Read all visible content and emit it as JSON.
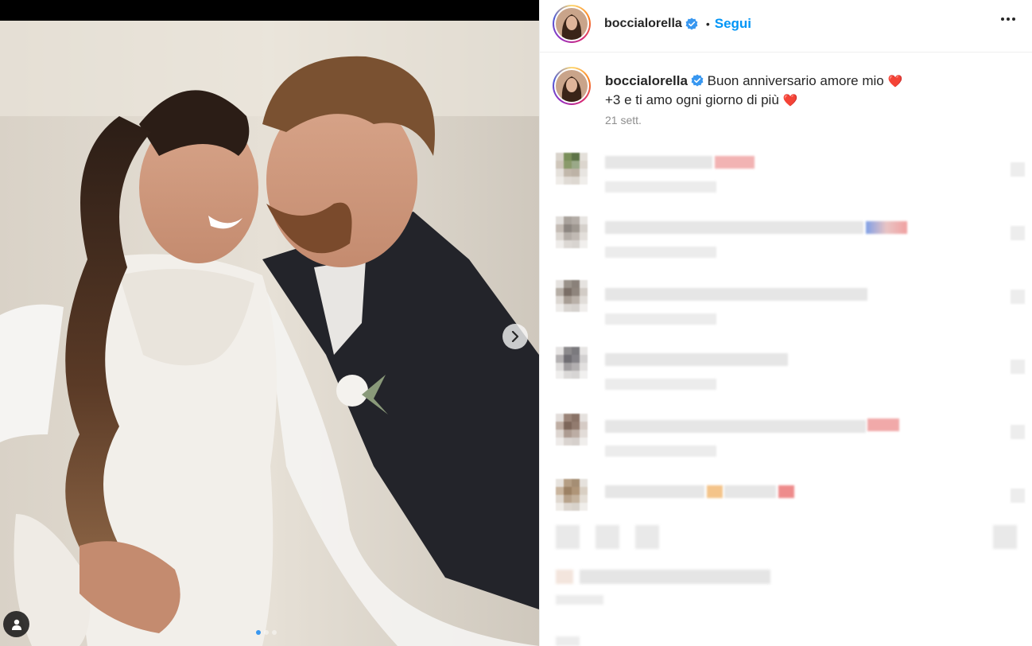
{
  "post": {
    "username": "boccialorella",
    "follow_label": "Segui",
    "separator": "•",
    "caption_line1": "Buon anniversario amore mio",
    "caption_line2": "+3 e ti amo ogni giorno di più",
    "caption_emoji": "❤️",
    "timestamp": "21 sett."
  },
  "media": {
    "current_slide": 1,
    "slide_count": 3
  },
  "icons": {
    "verified": "verified-badge-icon",
    "more": "more-options-icon",
    "next": "chevron-right-icon",
    "tag": "user-tag-icon"
  },
  "colors": {
    "accent": "#0095f6",
    "verified": "#3897f0",
    "heart": "#e0245e",
    "muted": "#8e8e8e"
  }
}
